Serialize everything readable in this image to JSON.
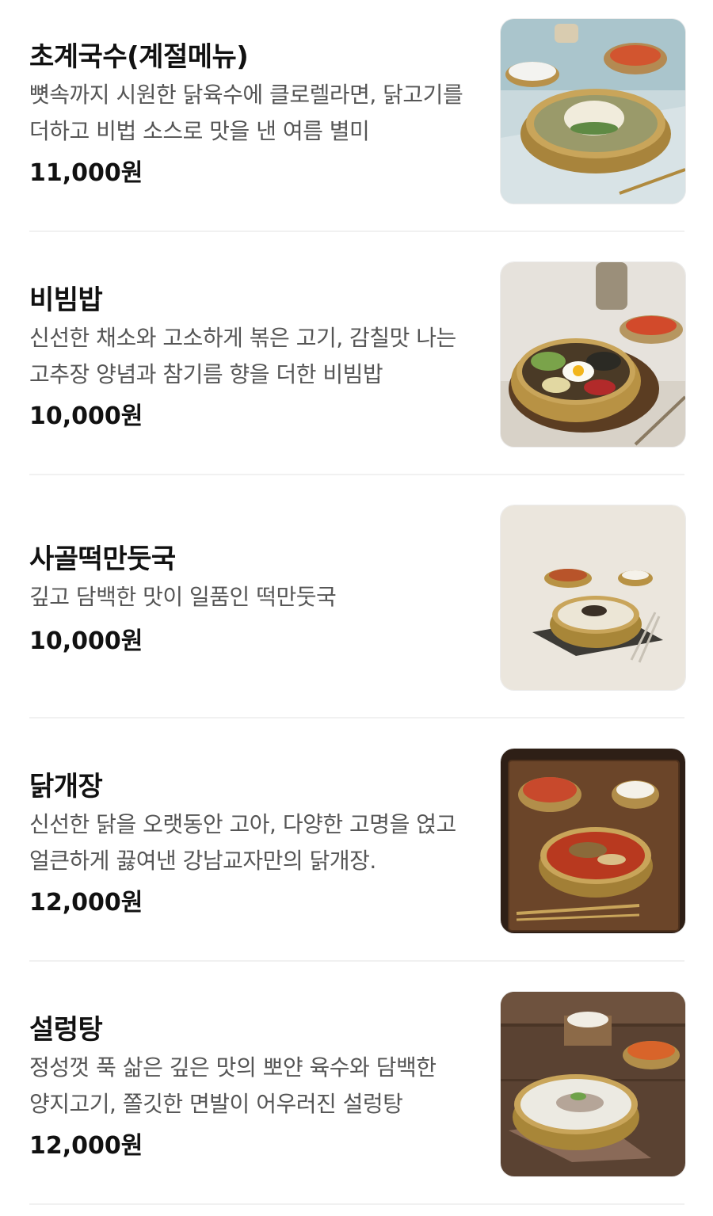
{
  "menu": {
    "items": [
      {
        "name": "초계국수(계절메뉴)",
        "description": "뼛속까지 시원한 닭육수에 클로렐라면, 닭고기를 더하고 비법 소스로 맛을 낸 여름 별미",
        "price": "11,000원",
        "photo_icon": "chogye-noodle-bowl-photo"
      },
      {
        "name": "비빔밥",
        "description": "신선한 채소와 고소하게 볶은 고기, 감칠맛 나는 고추장 양념과 참기름 향을 더한 비빔밥",
        "price": "10,000원",
        "photo_icon": "bibimbap-bowl-photo"
      },
      {
        "name": "사골떡만둣국",
        "description": "깊고 담백한 맛이 일품인 떡만둣국",
        "price": "10,000원",
        "photo_icon": "rice-cake-dumpling-soup-photo"
      },
      {
        "name": "닭개장",
        "description": "신선한 닭을 오랫동안 고아, 다양한 고명을 얹고 얼큰하게 끓여낸 강남교자만의 닭개장.",
        "price": "12,000원",
        "photo_icon": "spicy-chicken-soup-photo"
      },
      {
        "name": "설렁탕",
        "description": "정성껏 푹 삶은 깊은 맛의 뽀얀 육수와 담백한 양지고기, 쫄깃한 면발이 어우러진 설렁탕",
        "price": "12,000원",
        "photo_icon": "seolleongtang-bowl-photo"
      }
    ]
  },
  "colors": {
    "title": "#111111",
    "description": "#555555",
    "divider": "#f1f1f1",
    "brass_bowl": "#c9a55a"
  }
}
